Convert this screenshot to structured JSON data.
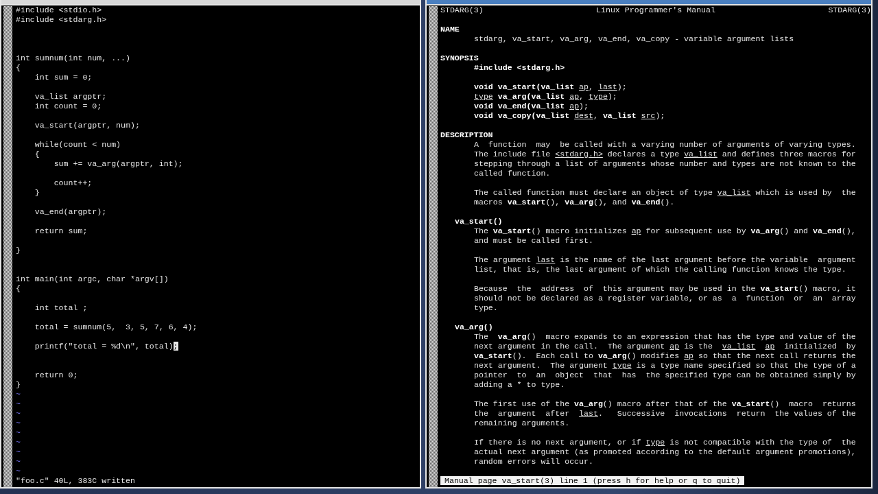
{
  "editor": {
    "code_top": "#include <stdio.h>\n#include <stdarg.h>\n\n\n\nint sumnum(int num, ...)\n{\n    int sum = 0;\n\n    va_list argptr;\n    int count = 0;\n\n    va_start(argptr, num);\n\n    while(count < num)\n    {\n        sum += va_arg(argptr, int);\n\n        count++;\n    }\n\n    va_end(argptr);\n\n    return sum;\n\n}\n\n\nint main(int argc, char *argv[])\n{\n\n    int total ;\n\n    total = sumnum(5,  3, 5, 7, 6, 4);",
    "cursor_line": {
      "text": "    printf(\"total = %d\\n\", total)",
      "cursor": ";"
    },
    "code_bottom": "\n\n    return 0;\n}",
    "empty_line_markers": [
      "~",
      "~",
      "~",
      "~",
      "~",
      "~",
      "~",
      "~",
      "~"
    ],
    "status": "\"foo.c\" 40L, 383C written"
  },
  "man_page": {
    "header": {
      "left": "STDARG(3)",
      "center": "Linux Programmer's Manual",
      "right": "STDARG(3)"
    },
    "sections": [
      {
        "kind": "section",
        "heading": "NAME",
        "paragraphs": [
          [
            "stdarg, va_start, va_arg, va_end, va_copy - variable argument lists"
          ]
        ]
      },
      {
        "kind": "section",
        "heading": "SYNOPSIS",
        "paragraphs": [
          [
            "**#include <stdarg.h>**"
          ],
          [
            "**void va_start(va_list** *ap*, *last*);",
            "*type* **va_arg(va_list** *ap*, *type*);",
            "**void va_end(va_list** *ap*);",
            "**void va_copy(va_list** *dest*, **va_list** *src*);"
          ]
        ]
      },
      {
        "kind": "section",
        "heading": "DESCRIPTION",
        "paragraphs": [
          [
            "A  function  may  be called with a varying number of arguments of varying types.",
            "The include file *<stdarg.h>* declares a type *va_list* and defines three macros for",
            "stepping through a list of arguments whose number and types are not known to the",
            "called function."
          ],
          [
            "The called function must declare an object of type *va_list* which is used by  the",
            "macros **va_start**(), **va_arg**(), and **va_end**()."
          ]
        ]
      },
      {
        "kind": "subsection",
        "heading": "va_start()",
        "paragraphs": [
          [
            "The **va_start**() macro initializes *ap* for subsequent use by **va_arg**() and **va_end**(),",
            "and must be called first."
          ],
          [
            "The argument *last* is the name of the last argument before the variable  argument",
            "list, that is, the last argument of which the calling function knows the type."
          ],
          [
            "Because  the  address  of  this argument may be used in the **va_start**() macro, it",
            "should not be declared as a register variable, or as  a  function  or  an  array",
            "type."
          ]
        ]
      },
      {
        "kind": "subsection",
        "heading": "va_arg()",
        "paragraphs": [
          [
            "The  **va_arg**()  macro expands to an expression that has the type and value of the",
            "next argument in the call.  The argument *ap* is the  *va_list*  *ap*  initialized  by",
            "**va_start**().  Each call to **va_arg**() modifies *ap* so that the next call returns the",
            "next argument.  The argument *type* is a type name specified so that the type of a",
            "pointer  to  an  object  that  has  the specified type can be obtained simply by",
            "adding a * to type."
          ],
          [
            "The first use of the **va_arg**() macro after that of the **va_start**()  macro  returns",
            "the  argument  after  *last*.   Successive  invocations  return  the values of the",
            "remaining arguments."
          ],
          [
            "If there is no next argument, or if *type* is not compatible with the type of  the",
            "actual next argument (as promoted according to the default argument promotions),",
            "random errors will occur."
          ]
        ]
      }
    ],
    "status": "Manual page va_start(3) line 1 (press h for help or q to quit)"
  }
}
